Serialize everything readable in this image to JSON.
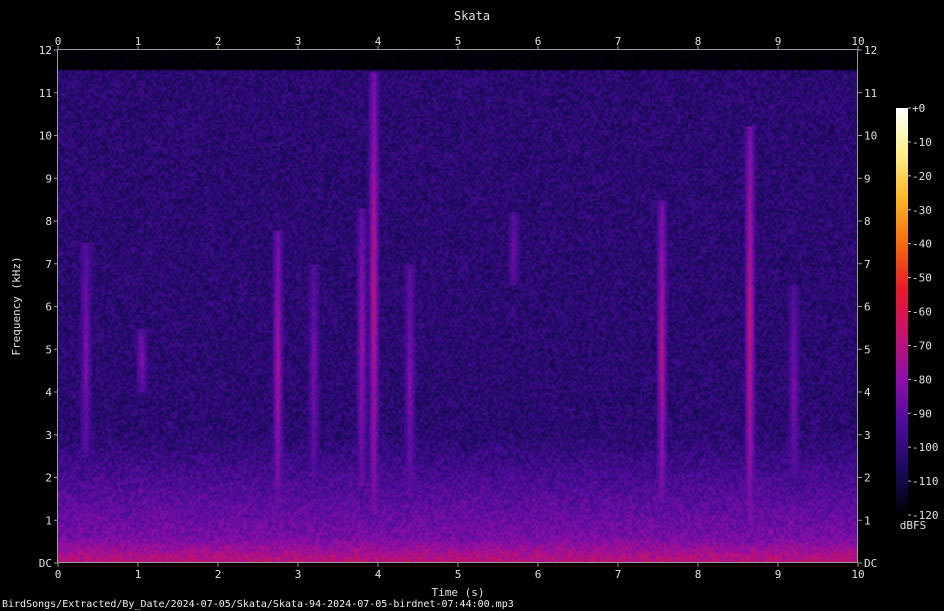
{
  "chart_data": {
    "type": "heatmap",
    "title": "Skata",
    "xlabel": "Time (s)",
    "ylabel": "Frequency (kHz)",
    "xlim": [
      0,
      10
    ],
    "ylim": [
      0,
      12
    ],
    "x_ticks": [
      "0",
      "1",
      "2",
      "3",
      "4",
      "5",
      "6",
      "7",
      "8",
      "9",
      "10"
    ],
    "y_ticks": [
      "DC",
      "1",
      "2",
      "3",
      "4",
      "5",
      "6",
      "7",
      "8",
      "9",
      "10",
      "11",
      "12"
    ],
    "colorbar": {
      "label": "dBFS",
      "range": [
        -120,
        0
      ],
      "ticks": [
        "+0",
        "-10",
        "-20",
        "-30",
        "-40",
        "-50",
        "-60",
        "-70",
        "-80",
        "-90",
        "-100",
        "-110",
        "-120"
      ],
      "colors": [
        "#000000",
        "#1a0a5c",
        "#4b0c9a",
        "#8a0fa8",
        "#c4126e",
        "#e81a2a",
        "#f56a10",
        "#fbb628",
        "#fff08a",
        "#ffffff"
      ]
    },
    "background_level_db": -100,
    "calls": [
      {
        "t": 0.35,
        "f_low": 2.5,
        "f_high": 7.5,
        "peak_db": -80
      },
      {
        "t": 1.05,
        "f_low": 4.0,
        "f_high": 5.5,
        "peak_db": -78
      },
      {
        "t": 2.75,
        "f_low": 1.5,
        "f_high": 7.8,
        "peak_db": -70
      },
      {
        "t": 3.2,
        "f_low": 2.0,
        "f_high": 7.0,
        "peak_db": -82
      },
      {
        "t": 3.8,
        "f_low": 1.8,
        "f_high": 8.3,
        "peak_db": -74
      },
      {
        "t": 3.95,
        "f_low": 1.2,
        "f_high": 11.5,
        "peak_db": -64
      },
      {
        "t": 4.4,
        "f_low": 1.5,
        "f_high": 7.0,
        "peak_db": -80
      },
      {
        "t": 5.7,
        "f_low": 6.5,
        "f_high": 8.2,
        "peak_db": -84
      },
      {
        "t": 7.55,
        "f_low": 1.4,
        "f_high": 8.5,
        "peak_db": -66
      },
      {
        "t": 8.65,
        "f_low": 1.0,
        "f_high": 10.2,
        "peak_db": -62
      },
      {
        "t": 9.2,
        "f_low": 2.0,
        "f_high": 6.5,
        "peak_db": -82
      }
    ]
  },
  "footer": {
    "path": "BirdSongs/Extracted/By_Date/2024-07-05/Skata/Skata-94-2024-07-05-birdnet-07:44:00.mp3"
  }
}
